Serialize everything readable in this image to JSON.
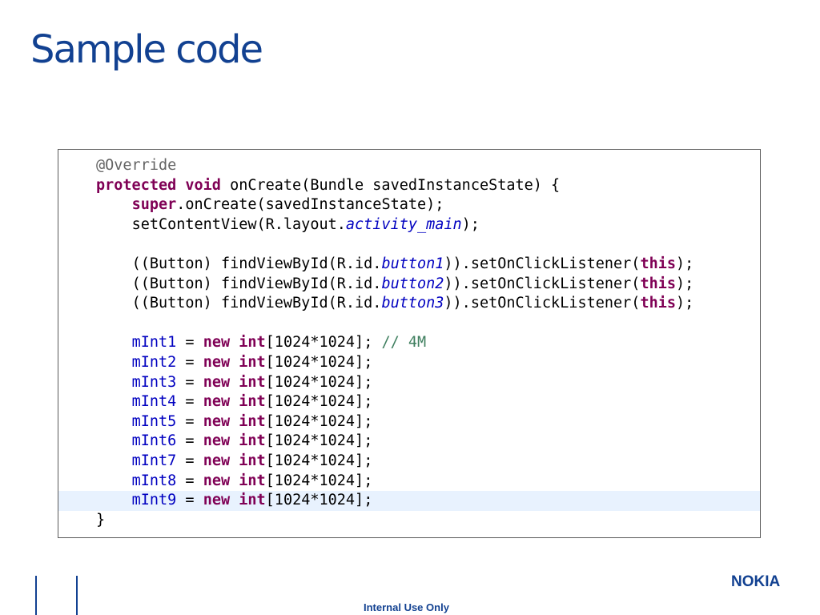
{
  "slide": {
    "title": "Sample code",
    "footer_label": "Internal Use Only",
    "logo_text": "NOKIA",
    "brand_color": "#124191"
  },
  "code": {
    "highlight_color": "#e8f2fe",
    "token_colors": {
      "kw": "#7f0055",
      "ann": "#646464",
      "fld": "#0000c0",
      "ital": "#0000c0",
      "cmt": "#3f7f5f",
      "txt": "#000000"
    },
    "lines": [
      {
        "indent": "",
        "tokens": [
          {
            "t": "ann",
            "v": "@Override"
          }
        ]
      },
      {
        "indent": "",
        "tokens": [
          {
            "t": "kw",
            "v": "protected"
          },
          {
            "t": "txt",
            "v": " "
          },
          {
            "t": "kw",
            "v": "void"
          },
          {
            "t": "txt",
            "v": " onCreate(Bundle savedInstanceState) {"
          }
        ]
      },
      {
        "indent": "    ",
        "tokens": [
          {
            "t": "kw",
            "v": "super"
          },
          {
            "t": "txt",
            "v": ".onCreate(savedInstanceState);"
          }
        ]
      },
      {
        "indent": "    ",
        "tokens": [
          {
            "t": "txt",
            "v": "setContentView(R.layout."
          },
          {
            "t": "ital",
            "v": "activity_main"
          },
          {
            "t": "txt",
            "v": ");"
          }
        ]
      },
      {
        "indent": "",
        "tokens": []
      },
      {
        "indent": "    ",
        "tokens": [
          {
            "t": "txt",
            "v": "((Button) findViewById(R.id."
          },
          {
            "t": "ital",
            "v": "button1"
          },
          {
            "t": "txt",
            "v": ")).setOnClickListener("
          },
          {
            "t": "kw",
            "v": "this"
          },
          {
            "t": "txt",
            "v": ");"
          }
        ]
      },
      {
        "indent": "    ",
        "tokens": [
          {
            "t": "txt",
            "v": "((Button) findViewById(R.id."
          },
          {
            "t": "ital",
            "v": "button2"
          },
          {
            "t": "txt",
            "v": ")).setOnClickListener("
          },
          {
            "t": "kw",
            "v": "this"
          },
          {
            "t": "txt",
            "v": ");"
          }
        ]
      },
      {
        "indent": "    ",
        "tokens": [
          {
            "t": "txt",
            "v": "((Button) findViewById(R.id."
          },
          {
            "t": "ital",
            "v": "button3"
          },
          {
            "t": "txt",
            "v": ")).setOnClickListener("
          },
          {
            "t": "kw",
            "v": "this"
          },
          {
            "t": "txt",
            "v": ");"
          }
        ]
      },
      {
        "indent": "",
        "tokens": []
      },
      {
        "indent": "    ",
        "tokens": [
          {
            "t": "fld",
            "v": "mInt1"
          },
          {
            "t": "txt",
            "v": " = "
          },
          {
            "t": "kw",
            "v": "new"
          },
          {
            "t": "txt",
            "v": " "
          },
          {
            "t": "kw",
            "v": "int"
          },
          {
            "t": "txt",
            "v": "[1024*1024]; "
          },
          {
            "t": "cmt",
            "v": "// 4M"
          }
        ]
      },
      {
        "indent": "    ",
        "tokens": [
          {
            "t": "fld",
            "v": "mInt2"
          },
          {
            "t": "txt",
            "v": " = "
          },
          {
            "t": "kw",
            "v": "new"
          },
          {
            "t": "txt",
            "v": " "
          },
          {
            "t": "kw",
            "v": "int"
          },
          {
            "t": "txt",
            "v": "[1024*1024];"
          }
        ]
      },
      {
        "indent": "    ",
        "tokens": [
          {
            "t": "fld",
            "v": "mInt3"
          },
          {
            "t": "txt",
            "v": " = "
          },
          {
            "t": "kw",
            "v": "new"
          },
          {
            "t": "txt",
            "v": " "
          },
          {
            "t": "kw",
            "v": "int"
          },
          {
            "t": "txt",
            "v": "[1024*1024];"
          }
        ]
      },
      {
        "indent": "    ",
        "tokens": [
          {
            "t": "fld",
            "v": "mInt4"
          },
          {
            "t": "txt",
            "v": " = "
          },
          {
            "t": "kw",
            "v": "new"
          },
          {
            "t": "txt",
            "v": " "
          },
          {
            "t": "kw",
            "v": "int"
          },
          {
            "t": "txt",
            "v": "[1024*1024];"
          }
        ]
      },
      {
        "indent": "    ",
        "tokens": [
          {
            "t": "fld",
            "v": "mInt5"
          },
          {
            "t": "txt",
            "v": " = "
          },
          {
            "t": "kw",
            "v": "new"
          },
          {
            "t": "txt",
            "v": " "
          },
          {
            "t": "kw",
            "v": "int"
          },
          {
            "t": "txt",
            "v": "[1024*1024];"
          }
        ]
      },
      {
        "indent": "    ",
        "tokens": [
          {
            "t": "fld",
            "v": "mInt6"
          },
          {
            "t": "txt",
            "v": " = "
          },
          {
            "t": "kw",
            "v": "new"
          },
          {
            "t": "txt",
            "v": " "
          },
          {
            "t": "kw",
            "v": "int"
          },
          {
            "t": "txt",
            "v": "[1024*1024];"
          }
        ]
      },
      {
        "indent": "    ",
        "tokens": [
          {
            "t": "fld",
            "v": "mInt7"
          },
          {
            "t": "txt",
            "v": " = "
          },
          {
            "t": "kw",
            "v": "new"
          },
          {
            "t": "txt",
            "v": " "
          },
          {
            "t": "kw",
            "v": "int"
          },
          {
            "t": "txt",
            "v": "[1024*1024];"
          }
        ]
      },
      {
        "indent": "    ",
        "tokens": [
          {
            "t": "fld",
            "v": "mInt8"
          },
          {
            "t": "txt",
            "v": " = "
          },
          {
            "t": "kw",
            "v": "new"
          },
          {
            "t": "txt",
            "v": " "
          },
          {
            "t": "kw",
            "v": "int"
          },
          {
            "t": "txt",
            "v": "[1024*1024];"
          }
        ]
      },
      {
        "indent": "    ",
        "highlight": true,
        "tokens": [
          {
            "t": "fld",
            "v": "mInt9"
          },
          {
            "t": "txt",
            "v": " = "
          },
          {
            "t": "kw",
            "v": "new"
          },
          {
            "t": "txt",
            "v": " "
          },
          {
            "t": "kw",
            "v": "int"
          },
          {
            "t": "txt",
            "v": "[1024*1024];"
          }
        ]
      },
      {
        "indent": "",
        "tokens": [
          {
            "t": "txt",
            "v": "}"
          }
        ]
      }
    ]
  }
}
